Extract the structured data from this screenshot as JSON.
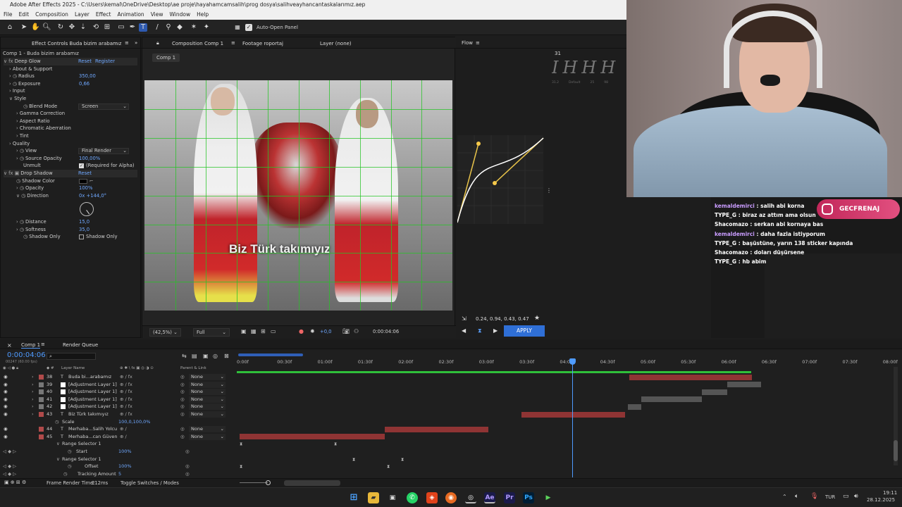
{
  "window": {
    "title": "Adobe After Effects 2025 - C:\\Users\\kemal\\OneDrive\\Desktop\\ae proje\\hayahamcamsalih\\prog dosya\\salihveayhancantaskalarımız.aep"
  },
  "menu": [
    "File",
    "Edit",
    "Composition",
    "Layer",
    "Effect",
    "Animation",
    "View",
    "Window",
    "Help"
  ],
  "toolbar": {
    "auto_open": "Auto-Open Panel"
  },
  "effects": {
    "tab": "Effect Controls Buda bizim arabamız",
    "path": "Comp 1 - Buda bizim arabamız",
    "deep_glow": "Deep Glow",
    "reset": "Reset",
    "register": "Register",
    "about": "About & Support",
    "radius_label": "Radius",
    "radius": "350,00",
    "exposure_label": "Exposure",
    "exposure": "0,66",
    "input": "Input",
    "style": "Style",
    "blend_label": "Blend Mode",
    "blend": "Screen",
    "gamma": "Gamma Correction",
    "aspect": "Aspect Ratio",
    "chromatic": "Chromatic Aberration",
    "tint": "Tint",
    "quality": "Quality",
    "view_label": "View",
    "view": "Final Render",
    "source_opacity_label": "Source Opacity",
    "source_opacity": "100,00%",
    "unmult_label": "Unmult",
    "unmult": "(Required for Alpha)",
    "drop_shadow": "Drop Shadow",
    "reset2": "Reset",
    "shadow_color": "Shadow Color",
    "opacity_label": "Opacity",
    "opacity": "100%",
    "direction_label": "Direction",
    "direction": "0x +144,0°",
    "distance_label": "Distance",
    "distance": "15,0",
    "softness_label": "Softness",
    "softness": "35,0",
    "shadow_only_label": "Shadow Only",
    "shadow_only": "Shadow Only"
  },
  "composition": {
    "tab": "Composition Comp 1",
    "footage_tab": "Footage roportaj",
    "layer_tab": "Layer (none)",
    "sub_tab": "Comp 1",
    "caption": "Biz Türk takımıyız",
    "zoom": "(42,5%)",
    "resolution": "Full",
    "exposure": "+0,0",
    "timecode": "0:00:04:06"
  },
  "flow": {
    "title": "Flow",
    "value": "31",
    "bezier": "0.24, 0.94, 0.43, 0.47",
    "apply": "APPLY",
    "preview_labels": [
      "31.2",
      "Default",
      "25",
      "98"
    ]
  },
  "stream": {
    "badge": "GECFRENAJ",
    "chat": [
      {
        "user": "kemaldemirci",
        "msg": "salih abi korna",
        "color": "#c99cff"
      },
      {
        "user": "TYPE_G",
        "msg": "biraz az attım ama olsun",
        "color": "#ffffff"
      },
      {
        "user": "Shacomazo",
        "msg": "serkan abi kornaya bas",
        "color": "#ffffff"
      },
      {
        "user": "kemaldemirci",
        "msg": "daha fazla istiyporum",
        "color": "#c99cff"
      },
      {
        "user": "TYPE_G",
        "msg": "başüstüne, yarın 138 sticker kapında",
        "color": "#ffffff"
      },
      {
        "user": "Shacomazo",
        "msg": "doları düşürsene",
        "color": "#ffffff"
      },
      {
        "user": "TYPE_G",
        "msg": "hb abim",
        "color": "#ffffff"
      }
    ]
  },
  "timeline": {
    "tab": "Comp 1",
    "render_queue": "Render Queue",
    "timecode": "0:00:04:06",
    "frames": "00247 (60.00 fps)",
    "col_name": "Layer Name",
    "col_parent": "Parent & Link",
    "ticks": [
      "0:00f",
      "00:30f",
      "01:00f",
      "01:30f",
      "02:00f",
      "02:30f",
      "03:00f",
      "03:30f",
      "04:00f",
      "04:30f",
      "05:00f",
      "05:30f",
      "06:00f",
      "06:30f",
      "07:00f",
      "07:30f",
      "08:00f"
    ],
    "layers": [
      {
        "num": "38",
        "type": "T",
        "name": "Buda bi...arabamız",
        "parent": "None",
        "color": "#b04a4a"
      },
      {
        "num": "39",
        "type": "",
        "name": "[Adjustment Layer 1]",
        "parent": "None",
        "color": "#777777"
      },
      {
        "num": "40",
        "type": "",
        "name": "[Adjustment Layer 1]",
        "parent": "None",
        "color": "#777777"
      },
      {
        "num": "41",
        "type": "",
        "name": "[Adjustment Layer 1]",
        "parent": "None",
        "color": "#777777"
      },
      {
        "num": "42",
        "type": "",
        "name": "[Adjustment Layer 1]",
        "parent": "None",
        "color": "#777777"
      },
      {
        "num": "43",
        "type": "T",
        "name": "Biz Türk takımıyız",
        "parent": "None",
        "color": "#b04a4a"
      }
    ],
    "scale_label": "Scale",
    "scale": "100,0,100,0%",
    "layers2": [
      {
        "num": "44",
        "type": "T",
        "name": "Merhaba...Salih Yolcu",
        "parent": "None"
      },
      {
        "num": "45",
        "type": "T",
        "name": "Merhaba...can Güven",
        "parent": "None"
      }
    ],
    "range1": "Range Selector 1",
    "start_label": "Start",
    "start": "100%",
    "range2": "Range Selector 1",
    "offset_label": "Offset",
    "offset": "100%",
    "tracking_label": "Tracking Amount",
    "tracking": "5",
    "frame_render": "Frame Render Time:",
    "frame_render_val": "212ms",
    "toggle": "Toggle Switches / Modes"
  },
  "taskbar": {
    "lang": "TUR",
    "time": "19:11",
    "date": "28.12.2025"
  }
}
